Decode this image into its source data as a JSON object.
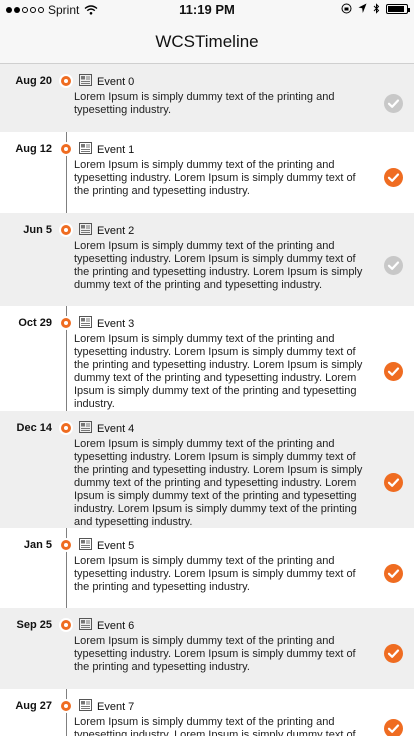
{
  "status_bar": {
    "carrier": "Sprint",
    "time": "11:19 PM"
  },
  "nav": {
    "title": "WCSTimeline"
  },
  "colors": {
    "accent": "#ef6c21",
    "done_gray": "#c8c8c8",
    "alt_row": "#efefef"
  },
  "icons": {
    "event": "document-icon",
    "status": "checkmark-circle-icon"
  },
  "events": [
    {
      "date": "Aug 20",
      "title": "Event 0",
      "lines": [
        "Lorem Ipsum is simply dummy text of the printing and",
        "typesetting industry."
      ],
      "checked": false
    },
    {
      "date": "Aug 12",
      "title": "Event 1",
      "lines": [
        "Lorem Ipsum is simply dummy text of the printing and",
        "typesetting industry. Lorem Ipsum is simply dummy text of",
        "the printing and typesetting industry."
      ],
      "checked": true
    },
    {
      "date": "Jun 5",
      "title": "Event 2",
      "lines": [
        "Lorem Ipsum is simply dummy text of the printing and",
        "typesetting industry. Lorem Ipsum is simply dummy text of",
        "the printing and typesetting industry. Lorem Ipsum is simply",
        "dummy text of the printing and typesetting industry."
      ],
      "checked": false
    },
    {
      "date": "Oct 29",
      "title": "Event 3",
      "lines": [
        "Lorem Ipsum is simply dummy text of the printing and",
        "typesetting industry. Lorem Ipsum is simply dummy text of",
        "the printing and typesetting industry. Lorem Ipsum is simply",
        "dummy text of the printing and typesetting industry. Lorem",
        "Ipsum is simply dummy text of the printing and typesetting",
        "industry."
      ],
      "checked": true
    },
    {
      "date": "Dec 14",
      "title": "Event 4",
      "lines": [
        "Lorem Ipsum is simply dummy text of the printing and",
        "typesetting industry. Lorem Ipsum is simply dummy text of",
        "the printing and typesetting industry. Lorem Ipsum is simply",
        "dummy text of the printing and typesetting industry. Lorem",
        "Ipsum is simply dummy text of the printing and typesetting",
        "industry. Lorem Ipsum is simply dummy text of the printing",
        "and typesetting industry."
      ],
      "checked": true
    },
    {
      "date": "Jan 5",
      "title": "Event 5",
      "lines": [
        "Lorem Ipsum is simply dummy text of the printing and",
        "typesetting industry. Lorem Ipsum is simply dummy text of",
        "the printing and typesetting industry."
      ],
      "checked": true
    },
    {
      "date": "Sep 25",
      "title": "Event 6",
      "lines": [
        "Lorem Ipsum is simply dummy text of the printing and",
        "typesetting industry. Lorem Ipsum is simply dummy text of",
        "the printing and typesetting industry."
      ],
      "checked": true
    },
    {
      "date": "Aug 27",
      "title": "Event 7",
      "lines": [
        "Lorem Ipsum is simply dummy text of the printing and",
        "typesetting industry. Lorem Ipsum is simply dummy text of"
      ],
      "checked": true
    }
  ]
}
